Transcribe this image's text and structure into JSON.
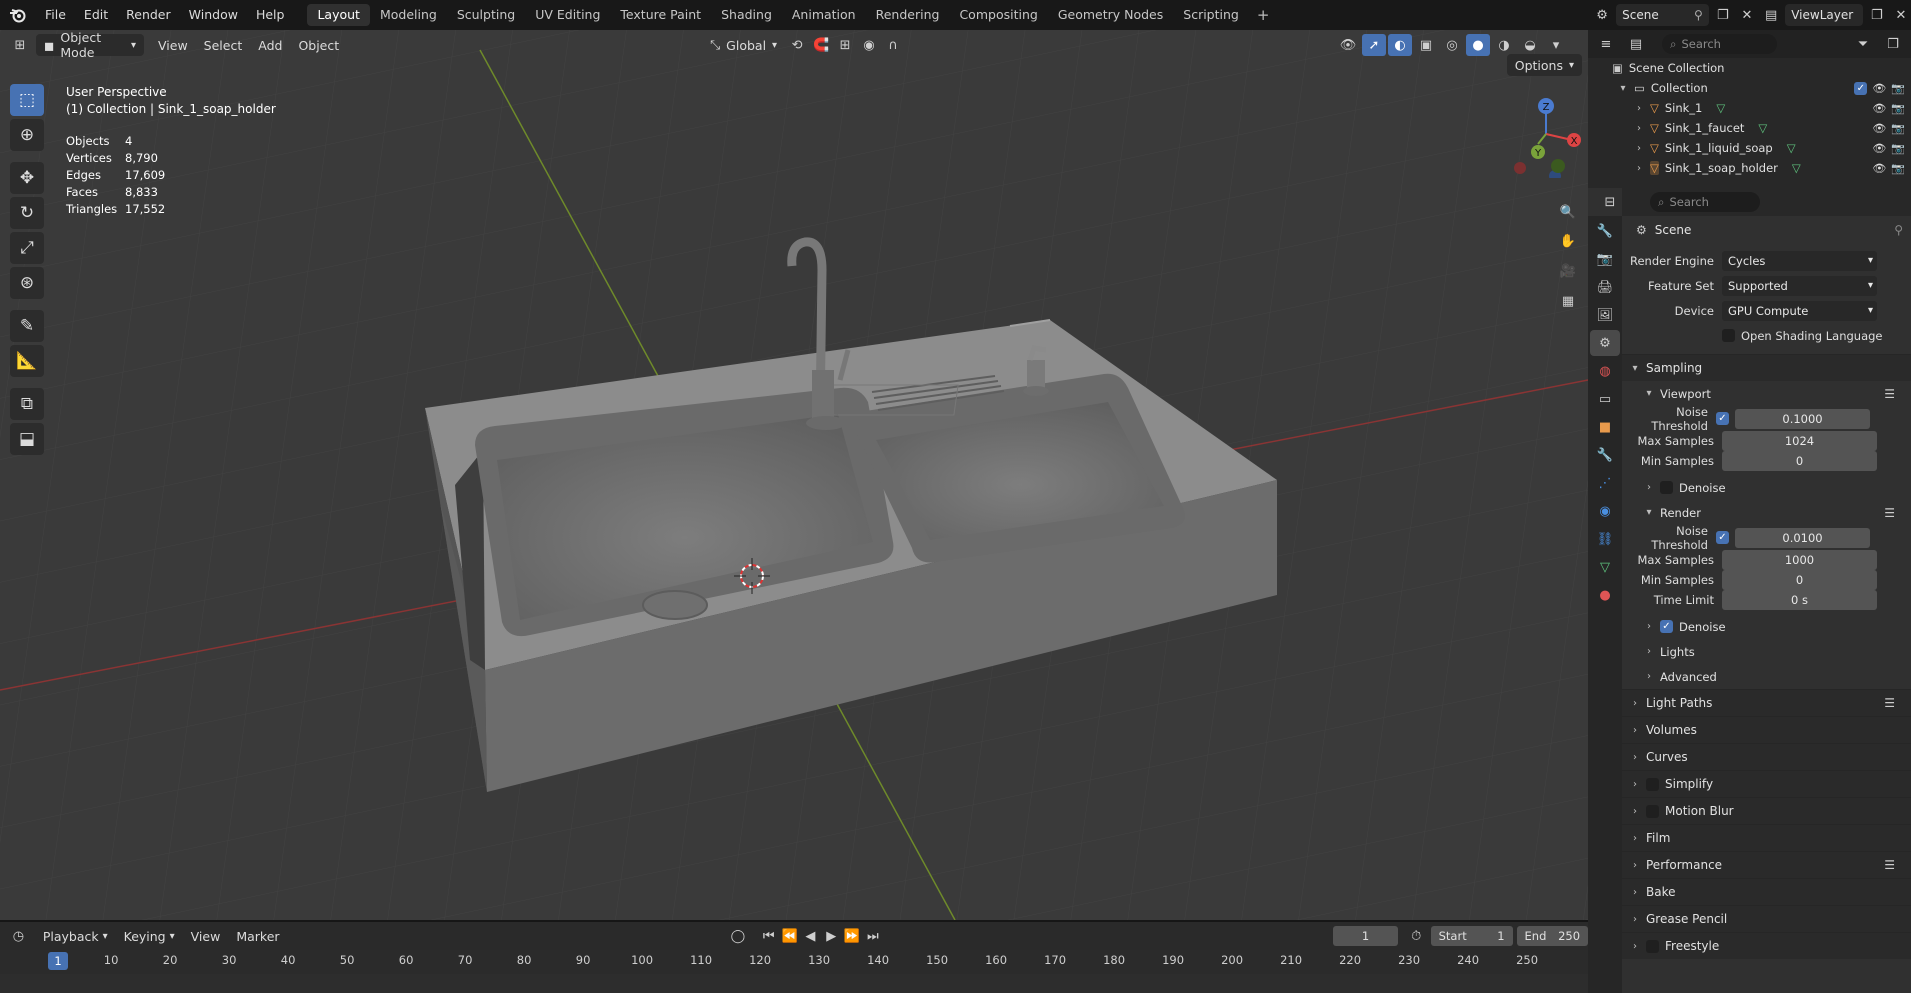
{
  "topbar": {
    "menus": [
      "File",
      "Edit",
      "Render",
      "Window",
      "Help"
    ],
    "workspaces": [
      "Layout",
      "Modeling",
      "Sculpting",
      "UV Editing",
      "Texture Paint",
      "Shading",
      "Animation",
      "Rendering",
      "Compositing",
      "Geometry Nodes",
      "Scripting"
    ],
    "active_workspace": "Layout",
    "scene": "Scene",
    "view_layer": "ViewLayer"
  },
  "viewport": {
    "mode": "Object Mode",
    "menus": [
      "View",
      "Select",
      "Add",
      "Object"
    ],
    "orientation": "Global",
    "options": "Options",
    "perspective": "User Perspective",
    "context": "(1) Collection | Sink_1_soap_holder",
    "stats": [
      {
        "label": "Objects",
        "value": "4"
      },
      {
        "label": "Vertices",
        "value": "8,790"
      },
      {
        "label": "Edges",
        "value": "17,609"
      },
      {
        "label": "Faces",
        "value": "8,833"
      },
      {
        "label": "Triangles",
        "value": "17,552"
      }
    ],
    "gizmo": {
      "x": "X",
      "y": "Y",
      "z": "Z"
    }
  },
  "outliner": {
    "search_placeholder": "Search",
    "scene_collection": "Scene Collection",
    "collection": "Collection",
    "objects": [
      "Sink_1",
      "Sink_1_faucet",
      "Sink_1_liquid_soap",
      "Sink_1_soap_holder"
    ]
  },
  "properties": {
    "search_placeholder": "Search",
    "breadcrumb": "Scene",
    "render_engine_label": "Render Engine",
    "render_engine": "Cycles",
    "feature_set_label": "Feature Set",
    "feature_set": "Supported",
    "device_label": "Device",
    "device": "GPU Compute",
    "osl_label": "Open Shading Language",
    "sampling": "Sampling",
    "viewport_sub": "Viewport",
    "noise_threshold_label": "Noise Threshold",
    "viewport_noise_threshold": "0.1000",
    "max_samples_label": "Max Samples",
    "viewport_max_samples": "1024",
    "min_samples_label": "Min Samples",
    "viewport_min_samples": "0",
    "denoise_label": "Denoise",
    "render_sub": "Render",
    "render_noise_threshold": "0.0100",
    "render_max_samples": "1000",
    "render_min_samples": "0",
    "time_limit_label": "Time Limit",
    "render_time_limit": "0 s",
    "lights": "Lights",
    "advanced": "Advanced",
    "panels": [
      "Light Paths",
      "Volumes",
      "Curves",
      "Simplify",
      "Motion Blur",
      "Film",
      "Performance",
      "Bake",
      "Grease Pencil",
      "Freestyle"
    ]
  },
  "timeline": {
    "menus": [
      "Playback",
      "Keying",
      "View",
      "Marker"
    ],
    "current_frame": "1",
    "start_label": "Start",
    "start": "1",
    "end_label": "End",
    "end": "250",
    "ticks": [
      "1",
      "10",
      "20",
      "30",
      "40",
      "50",
      "60",
      "70",
      "80",
      "90",
      "100",
      "110",
      "120",
      "130",
      "140",
      "150",
      "160",
      "170",
      "180",
      "190",
      "200",
      "210",
      "220",
      "230",
      "240",
      "250"
    ]
  }
}
